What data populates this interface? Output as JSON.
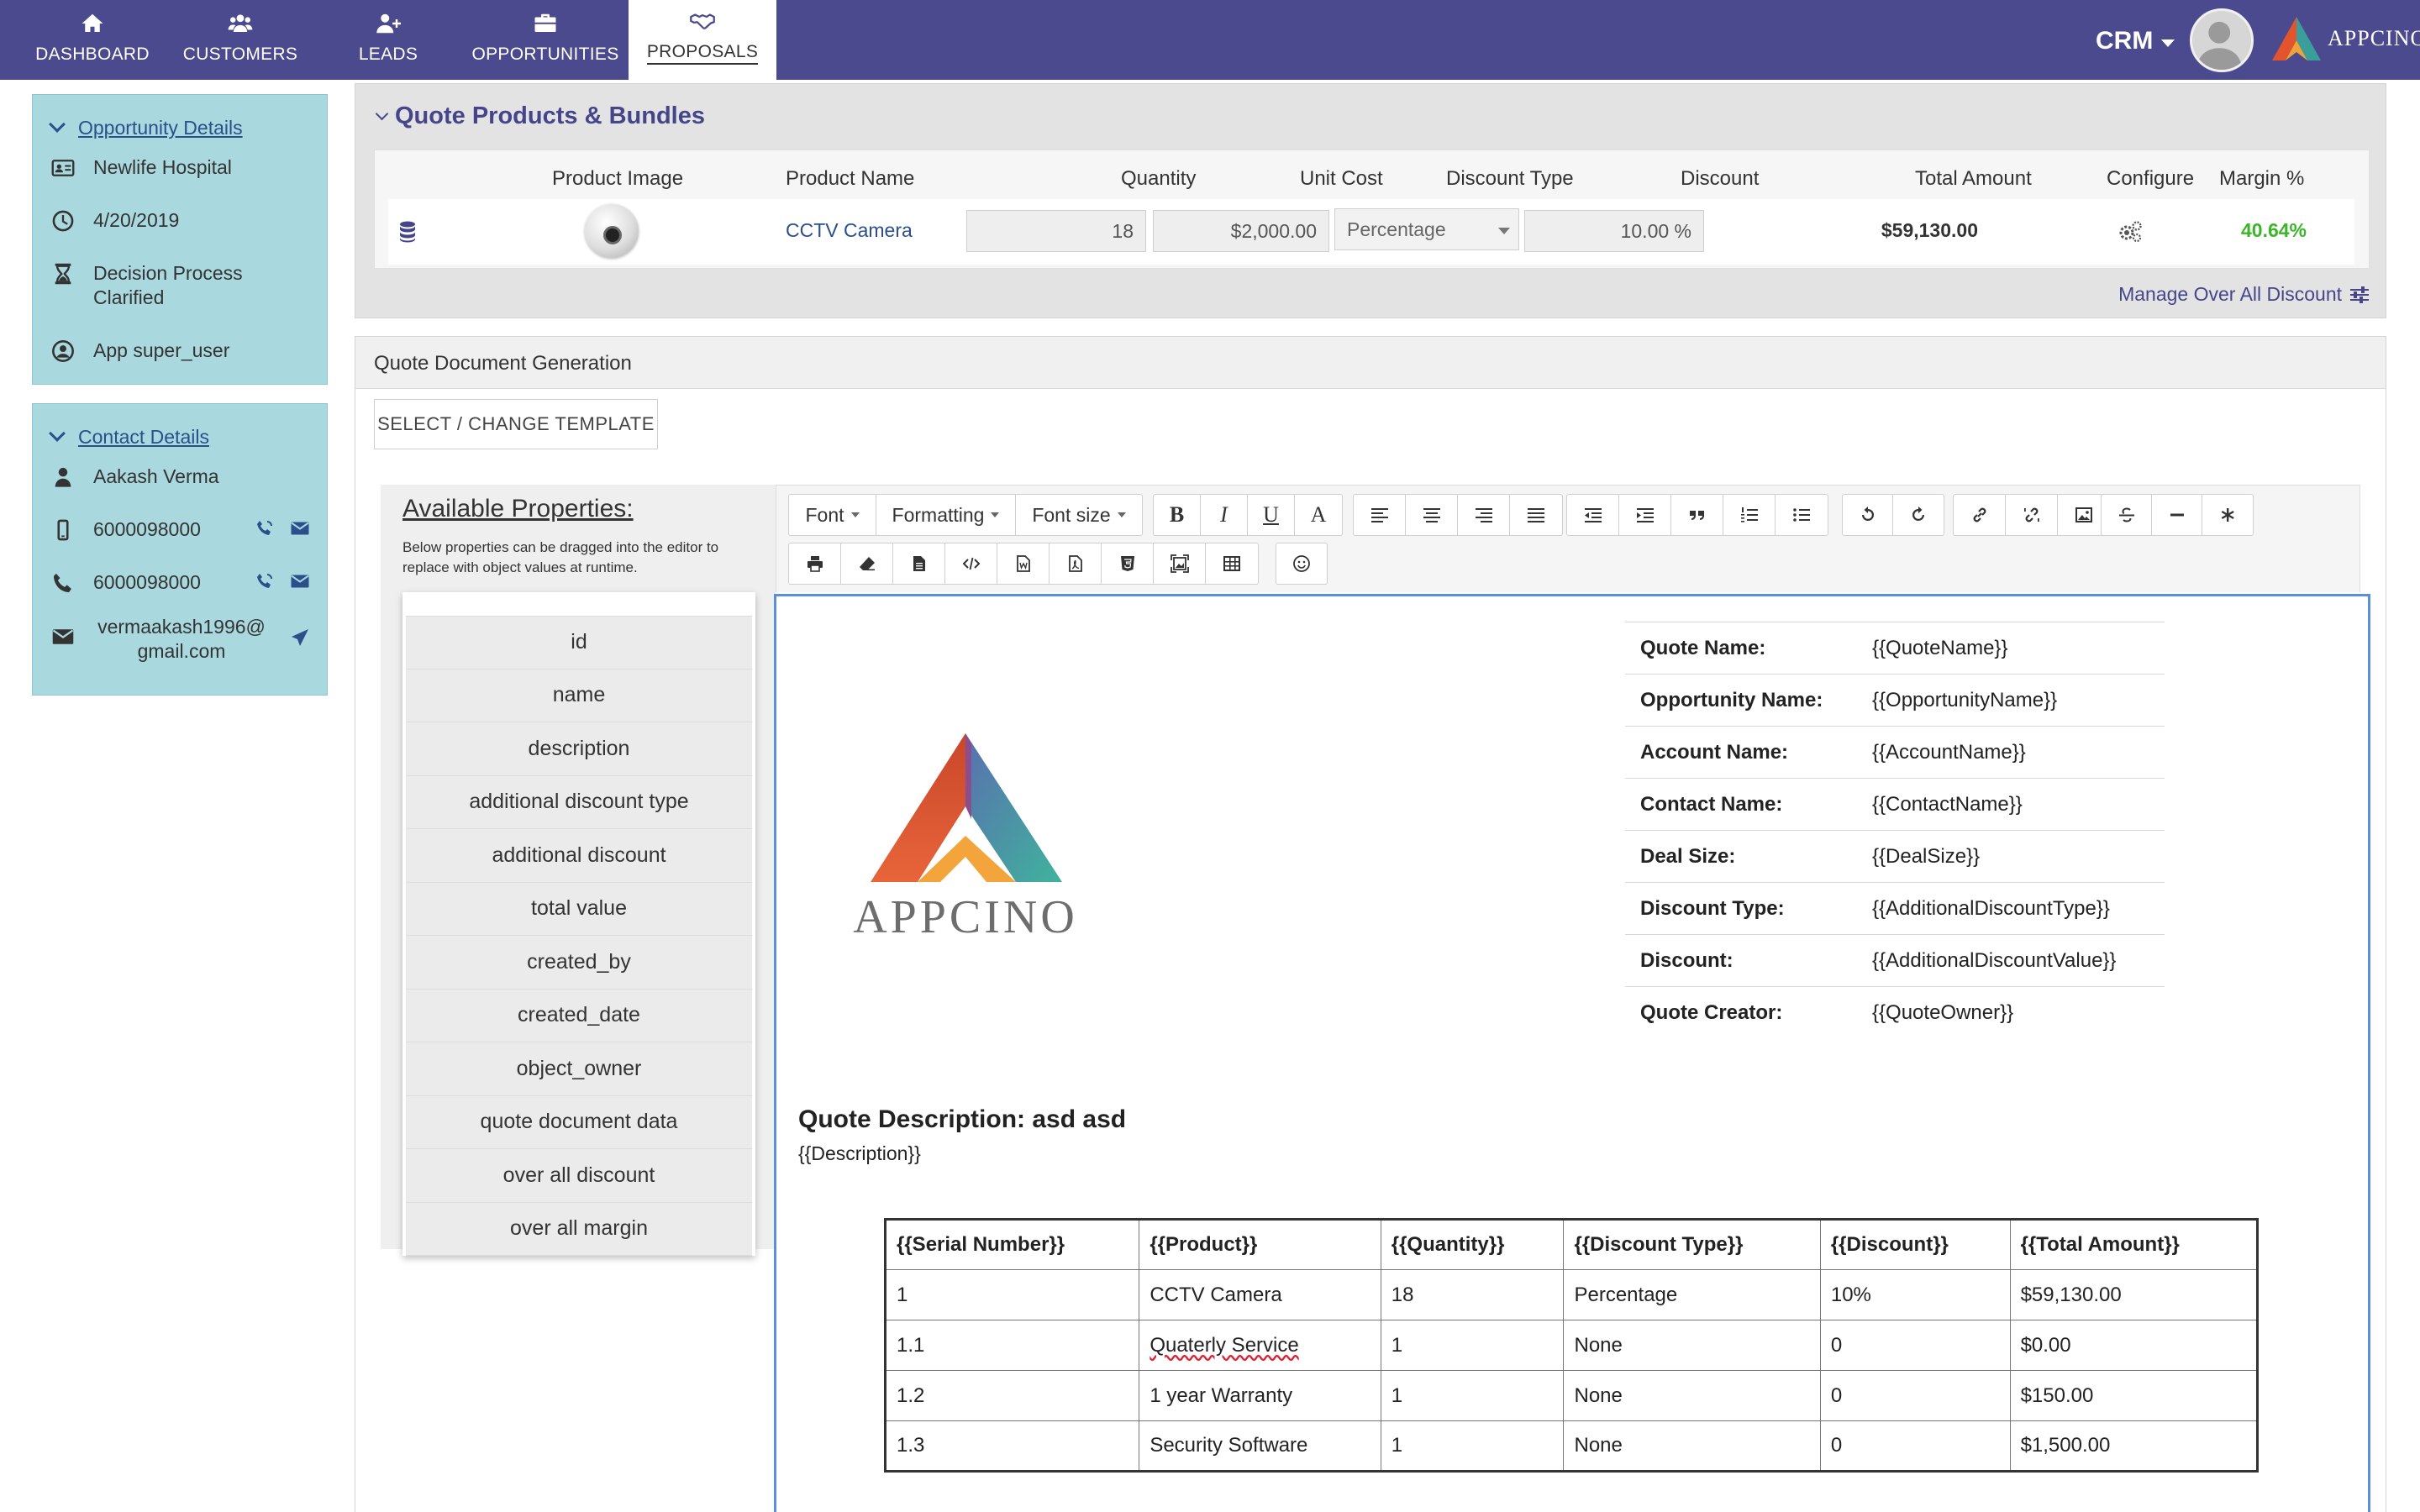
{
  "nav": {
    "items": [
      {
        "label": "DASHBOARD",
        "icon": "home-icon"
      },
      {
        "label": "CUSTOMERS",
        "icon": "users-icon"
      },
      {
        "label": "LEADS",
        "icon": "user-plus-icon"
      },
      {
        "label": "OPPORTUNITIES",
        "icon": "briefcase-icon"
      },
      {
        "label": "PROPOSALS",
        "icon": "handshake-icon",
        "active": true
      }
    ],
    "crm_label": "CRM",
    "brand": "APPCINO"
  },
  "opportunity": {
    "header": "Opportunity Details",
    "account": "Newlife Hospital",
    "date": "4/20/2019",
    "stage": "Decision Process Clarified",
    "owner": "App super_user"
  },
  "contact": {
    "header": "Contact Details",
    "name": "Aakash Verma",
    "mobile": "6000098000",
    "phone": "6000098000",
    "email": "vermaakash1996@gmail.com"
  },
  "quote_products": {
    "title": "Quote Products & Bundles",
    "columns": [
      "Product Image",
      "Product Name",
      "Quantity",
      "Unit Cost",
      "Discount Type",
      "Discount",
      "Total Amount",
      "Configure",
      "Margin %"
    ],
    "row": {
      "product_name": "CCTV Camera",
      "quantity": "18",
      "unit_cost": "$2,000.00",
      "discount_type": "Percentage",
      "discount": "10.00 %",
      "total_amount": "$59,130.00",
      "margin": "40.64%"
    },
    "manage_label": "Manage Over All Discount",
    "margin_color": "#3cb528"
  },
  "doc_gen": {
    "header": "Quote Document Generation",
    "template_button": "SELECT / CHANGE TEMPLATE",
    "properties_title": "Available Properties:",
    "properties_subtitle": "Below properties can be dragged into the editor to replace with object values at runtime.",
    "properties": [
      "id",
      "name",
      "description",
      "additional discount type",
      "additional discount",
      "total value",
      "created_by",
      "created_date",
      "object_owner",
      "quote document data",
      "over all discount",
      "over all margin"
    ],
    "toolbar": {
      "font": "Font",
      "formatting": "Formatting",
      "font_size": "Font size"
    }
  },
  "document": {
    "logo_text": "APPCINO",
    "info": [
      {
        "k": "Quote Name:",
        "v": "{{QuoteName}}"
      },
      {
        "k": "Opportunity Name:",
        "v": "{{OpportunityName}}"
      },
      {
        "k": "Account Name:",
        "v": "{{AccountName}}"
      },
      {
        "k": "Contact Name:",
        "v": "{{ContactName}}"
      },
      {
        "k": "Deal Size:",
        "v": "{{DealSize}}"
      },
      {
        "k": "Discount Type:",
        "v": "{{AdditionalDiscountType}}"
      },
      {
        "k": "Discount:",
        "v": "{{AdditionalDiscountValue}}"
      },
      {
        "k": "Quote Creator:",
        "v": "{{QuoteOwner}}"
      }
    ],
    "desc_title": "Quote Description: asd asd",
    "desc_body": "{{Description}}",
    "table_headers": [
      "{{Serial Number}}",
      "{{Product}}",
      "{{Quantity}}",
      "{{Discount Type}}",
      "{{Discount}}",
      "{{Total Amount}}"
    ],
    "rows": [
      [
        "1",
        "CCTV Camera",
        "18",
        "Percentage",
        "10%",
        "$59,130.00"
      ],
      [
        "1.1",
        "Quaterly Service",
        "1",
        "None",
        "0",
        "$0.00"
      ],
      [
        "1.2",
        "1 year Warranty",
        "1",
        "None",
        "0",
        "$150.00"
      ],
      [
        "1.3",
        "Security Software",
        "1",
        "None",
        "0",
        "$1,500.00"
      ]
    ]
  },
  "colors": {
    "nav_bg": "#4b4a8e",
    "sidebar_bg": "#a9d8df",
    "link": "#2a4f8a",
    "editor_border": "#5b8fd9"
  }
}
